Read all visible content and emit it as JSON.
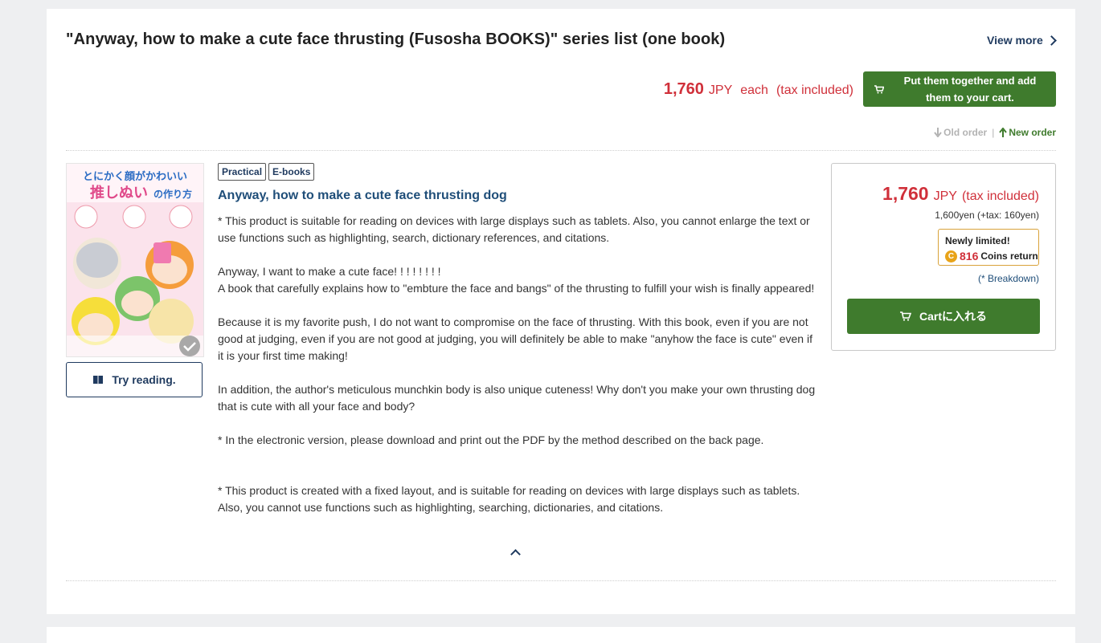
{
  "series": {
    "title": "\"Anyway, how to make a cute face thrusting (Fusosha BOOKS)\" series list (one book)",
    "view_more": "View more"
  },
  "bulk": {
    "price": "1,760",
    "currency": "JPY",
    "each": "each",
    "tax_note": "(tax included)",
    "button_label": "Put them together and add them to your cart."
  },
  "order": {
    "old": "Old order",
    "separator": "|",
    "new": "New order"
  },
  "book": {
    "cover_title_line1": "とにかく顔がかわいい",
    "cover_title_line2": "推しぬい",
    "cover_title_line3": "の作り方",
    "try_reading": "Try reading.",
    "tags": [
      "Practical",
      "E-books"
    ],
    "title": "Anyway, how to make a cute face thrusting dog",
    "description": {
      "p1": "* This product is suitable for reading on devices with large displays such as tablets. Also, you cannot enlarge the text or use functions such as highlighting, search, dictionary references, and citations.",
      "p2": "Anyway, I want to make a cute face! ! ! ! ! ! ! !",
      "p3": "A book that carefully explains how to \"embture the face and bangs\" of the thrusting to fulfill your wish is finally appeared!",
      "p4": "Because it is my favorite push, I do not want to compromise on the face of thrusting. With this book, even if you are not good at judging, even if you are not good at judging, you will definitely be able to make \"anyhow the face is cute\" even if it is your first time making!",
      "p5": "In addition, the author's meticulous munchkin body is also unique cuteness! Why don't you make your own thrusting dog that is cute with all your face and body?",
      "p6": "* In the electronic version, please download and print out the PDF by the method described on the back page.",
      "p7": "* This product is created with a fixed layout, and is suitable for reading on devices with large displays such as tablets. Also, you cannot use functions such as highlighting, searching, dictionaries, and citations."
    }
  },
  "pricebox": {
    "price": "1,760",
    "currency": "JPY",
    "tax_note": "(tax included)",
    "sub": "1,600yen (+tax: 160yen)",
    "limited": "Newly limited!",
    "coin_symbol": "C",
    "coins": "816",
    "coins_label": "Coins return",
    "breakdown": "(* Breakdown)",
    "cart_label": "Cartに入れる"
  },
  "colors": {
    "accent_green": "#3f7b2d",
    "price_red": "#d0303a",
    "navy": "#1f3a5f"
  }
}
